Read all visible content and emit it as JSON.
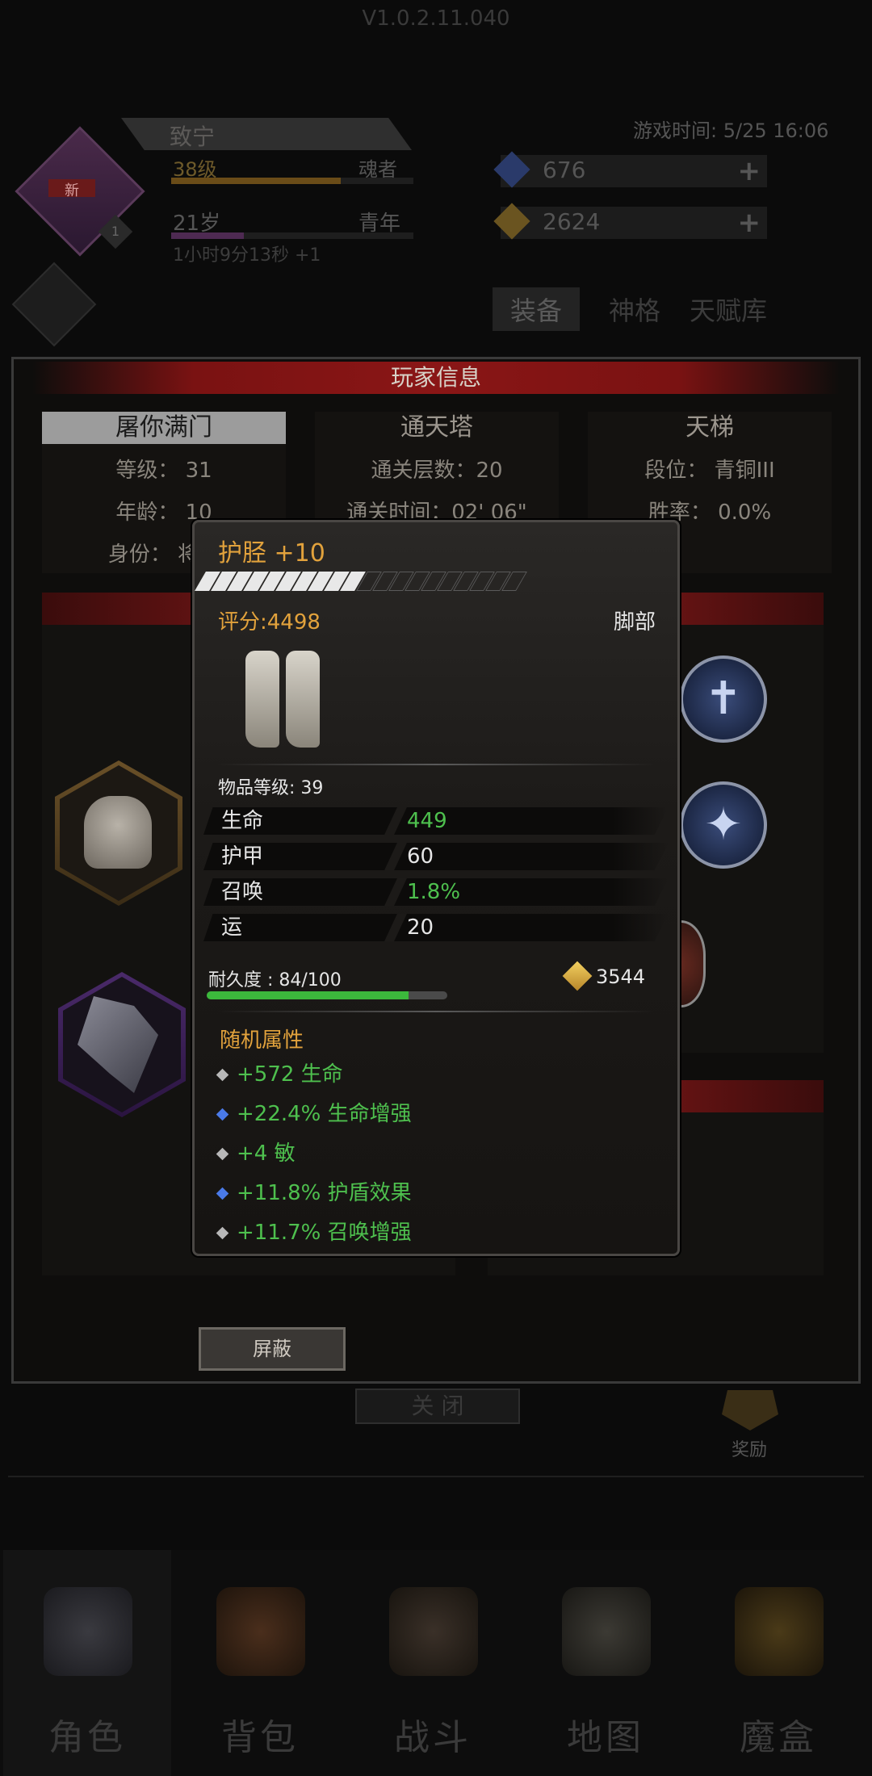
{
  "version": "V1.0.2.11.040",
  "player_hud": {
    "name": "致宁",
    "new_tag": "新",
    "rank_num": "1",
    "level": "38级",
    "class": "魂者",
    "age": "21岁",
    "stage": "青年",
    "timer": "1小时9分13秒 +1",
    "game_time": "游戏时间: 5/25 16:06",
    "gems": "676",
    "gold": "2624"
  },
  "top_tabs": [
    "装备",
    "神格",
    "天赋库"
  ],
  "panel": {
    "title": "玩家信息",
    "cards": [
      {
        "head": "屠你满门",
        "lines": [
          "等级：  31",
          "年龄：  10",
          "身份：  将士"
        ]
      },
      {
        "head": "通天塔",
        "lines": [
          "通关层数：20",
          "通关时间：02' 06\""
        ]
      },
      {
        "head": "天梯",
        "lines": [
          "段位：  青铜III",
          "胜率：  0.0%"
        ]
      }
    ],
    "block_button": "屏蔽",
    "close_button": "关 闭",
    "reward_label": "奖励"
  },
  "tooltip": {
    "title": "护胫 +10",
    "stars_filled": 10,
    "stars_total": 20,
    "score": "评分:4498",
    "slot": "脚部",
    "item_level": "物品等级: 39",
    "stats": [
      {
        "k": "生命",
        "v": "449",
        "color": "green"
      },
      {
        "k": "护甲",
        "v": "60",
        "color": "white"
      },
      {
        "k": "召唤",
        "v": "1.8%",
        "color": "green"
      },
      {
        "k": "运",
        "v": "20",
        "color": "white"
      }
    ],
    "durability_label": "耐久度 : 84/100",
    "durability_fraction": 0.84,
    "sell_price": "3544",
    "random_title": "随机属性",
    "random_attrs": [
      {
        "text": "+572  生命",
        "dot": "grey"
      },
      {
        "text": "+22.4%  生命增强",
        "dot": "blue"
      },
      {
        "text": "+4  敏",
        "dot": "grey"
      },
      {
        "text": "+11.8%  护盾效果",
        "dot": "blue"
      },
      {
        "text": "+11.7%  召唤增强",
        "dot": "grey"
      }
    ]
  },
  "nav": [
    {
      "label": "角色",
      "icon": "helmet-icon"
    },
    {
      "label": "背包",
      "icon": "backpack-icon"
    },
    {
      "label": "战斗",
      "icon": "sword-shield-icon"
    },
    {
      "label": "地图",
      "icon": "scroll-map-icon"
    },
    {
      "label": "魔盒",
      "icon": "magic-box-icon"
    }
  ],
  "colors": {
    "accent_gold": "#e2a23c",
    "stat_green": "#4ec04e",
    "panel_red": "#8a1616"
  }
}
